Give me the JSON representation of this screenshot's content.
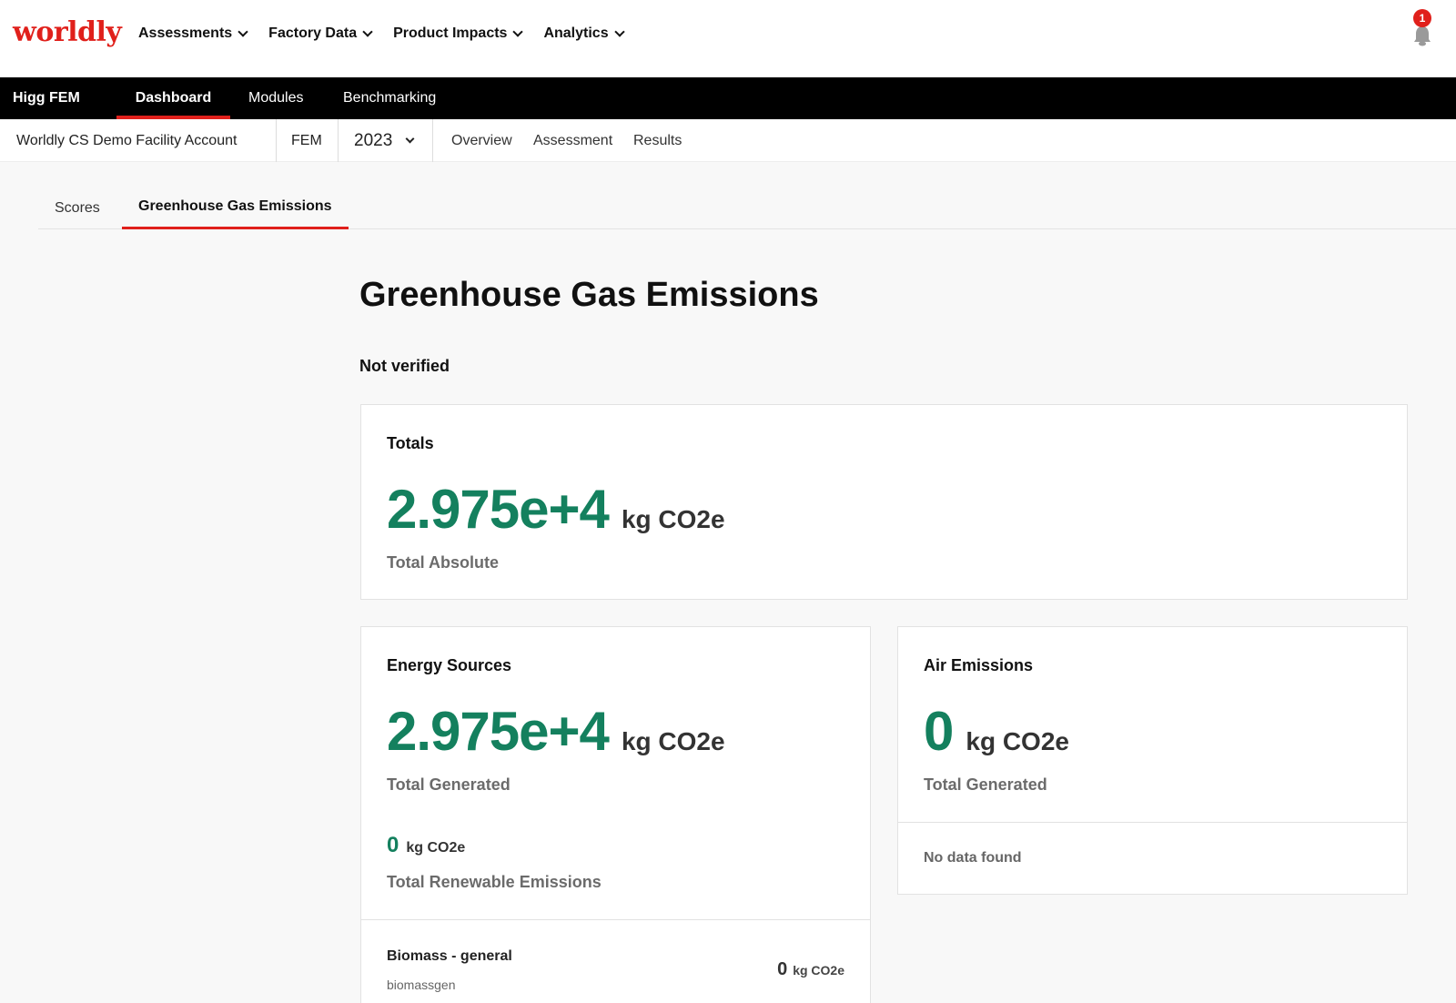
{
  "header": {
    "logo": "worldly",
    "menu": [
      "Assessments",
      "Factory Data",
      "Product Impacts",
      "Analytics"
    ],
    "notification_count": "1"
  },
  "blackbar": {
    "brand": "Higg FEM",
    "tabs": [
      "Dashboard",
      "Modules",
      "Benchmarking"
    ]
  },
  "subbar": {
    "account": "Worldly CS Demo Facility Account",
    "module": "FEM",
    "year": "2023",
    "links": [
      "Overview",
      "Assessment",
      "Results"
    ]
  },
  "page_tabs": [
    "Scores",
    "Greenhouse Gas Emissions"
  ],
  "main": {
    "title": "Greenhouse Gas Emissions",
    "verification": "Not verified",
    "totals": {
      "title": "Totals",
      "value": "2.975e+4",
      "unit": "kg CO2e",
      "label": "Total Absolute"
    },
    "energy": {
      "title": "Energy Sources",
      "value": "2.975e+4",
      "unit": "kg CO2e",
      "label": "Total Generated",
      "renewable_value": "0",
      "renewable_unit": "kg CO2e",
      "renewable_label": "Total Renewable Emissions",
      "item_name": "Biomass - general",
      "item_code": "biomassgen",
      "item_value": "0",
      "item_unit": "kg CO2e"
    },
    "air": {
      "title": "Air Emissions",
      "value": "0",
      "unit": "kg CO2e",
      "label": "Total Generated",
      "empty": "No data found"
    }
  },
  "colors": {
    "brand_red": "#e0201b",
    "value_green": "#14805e"
  }
}
